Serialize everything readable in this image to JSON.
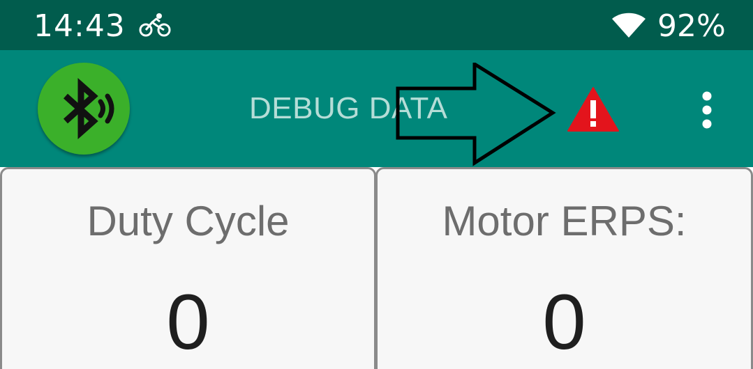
{
  "status_bar": {
    "time": "14:43",
    "battery_percent": "92%",
    "icons": [
      "bike-icon",
      "wifi-icon"
    ]
  },
  "app_bar": {
    "title": "DEBUG DATA",
    "bluetooth_button_icon": "bluetooth-connecting-icon",
    "bluetooth_button_color": "#3bb02a",
    "annotation_icon": "arrow-right-outline-icon",
    "warning_icon": "warning-triangle-icon",
    "warning_color": "#e3141c",
    "menu_icon": "more-vert-icon",
    "background_color": "#00877a"
  },
  "cards": [
    {
      "label": "Duty Cycle",
      "value": "0"
    },
    {
      "label": "Motor ERPS:",
      "value": "0"
    }
  ],
  "colors": {
    "status_bar": "#015c4d",
    "app_bar": "#00877a",
    "card_background": "#f7f7f7"
  }
}
